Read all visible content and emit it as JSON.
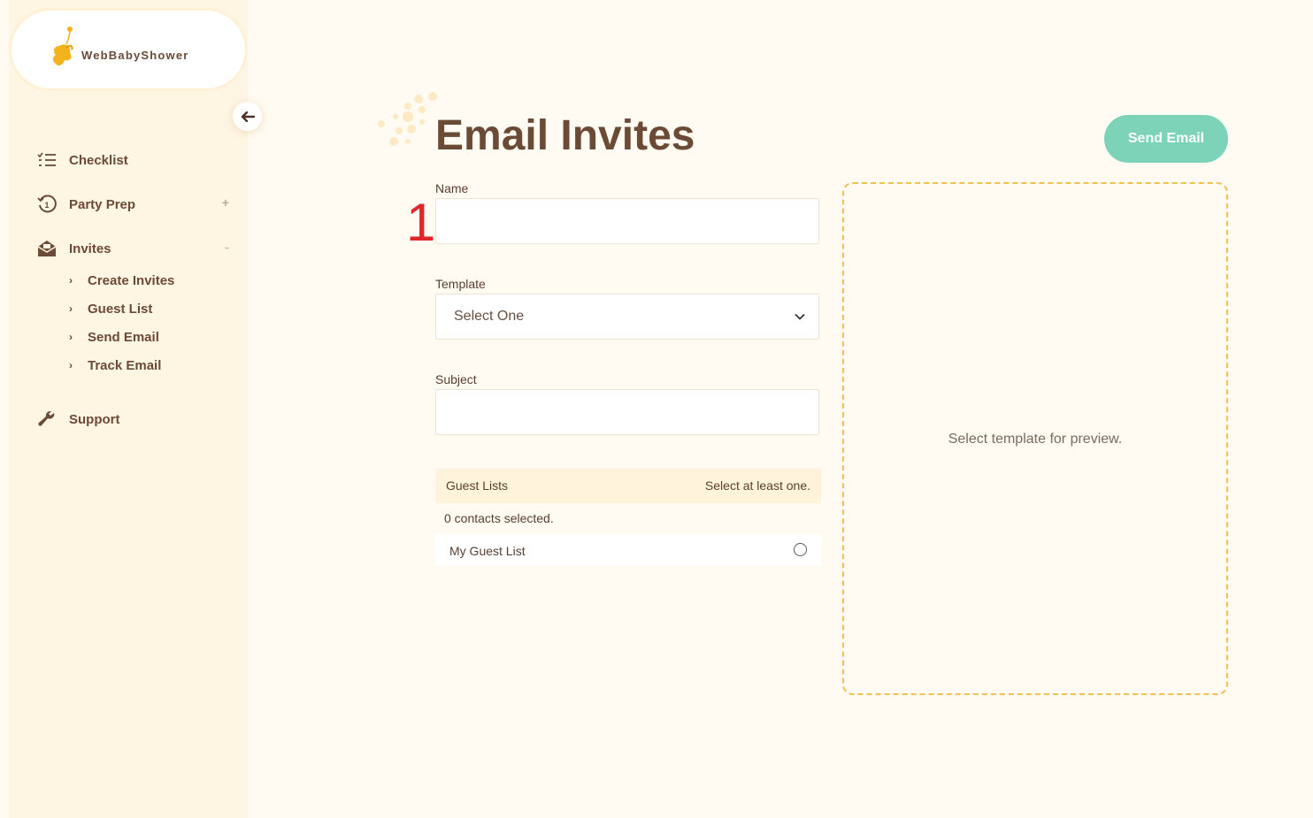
{
  "brand": {
    "name": "WebBabyShower"
  },
  "sidebar": {
    "items": [
      {
        "label": "Checklist",
        "icon": "checklist-icon"
      },
      {
        "label": "Party Prep",
        "icon": "history-icon",
        "trail": "+"
      },
      {
        "label": "Invites",
        "icon": "envelope-open-icon",
        "trail": "–"
      },
      {
        "label": "Support",
        "icon": "wrench-icon"
      }
    ],
    "invites_sub": [
      {
        "label": "Create Invites"
      },
      {
        "label": "Guest List"
      },
      {
        "label": "Send Email"
      },
      {
        "label": "Track Email"
      }
    ]
  },
  "main": {
    "title": "Email Invites",
    "send_button": "Send Email",
    "marker": "1",
    "form": {
      "name_label": "Name",
      "name_value": "",
      "template_label": "Template",
      "template_value": "Select One",
      "subject_label": "Subject",
      "subject_value": ""
    },
    "guest_lists": {
      "title": "Guest Lists",
      "hint": "Select at least one.",
      "contacts_selected": "0 contacts selected.",
      "rows": [
        {
          "name": "My Guest List"
        }
      ]
    },
    "preview_text": "Select template for preview."
  },
  "colors": {
    "accent": "#7cd3b8",
    "brown": "#6b4a36",
    "dash": "#f0c24c",
    "marker": "#e0262b"
  }
}
